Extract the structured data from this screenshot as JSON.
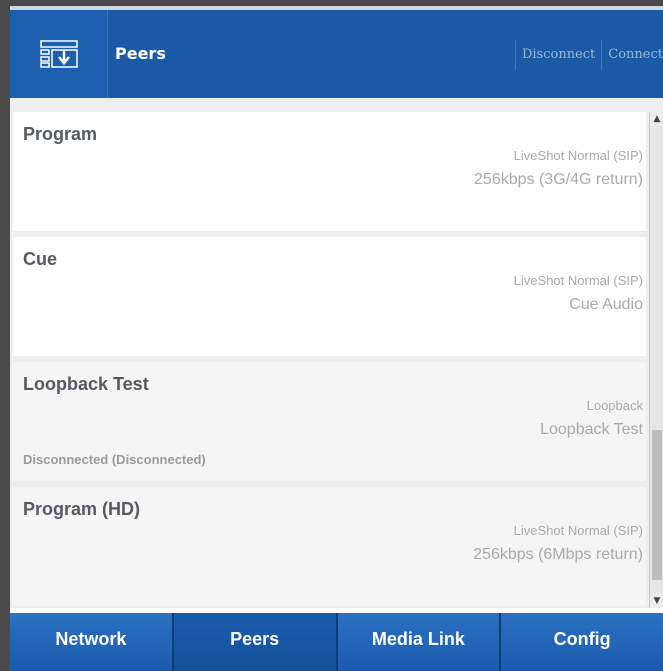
{
  "header": {
    "title": "Peers",
    "actions": [
      "Disconnect",
      "Connect"
    ]
  },
  "peers": [
    {
      "name": "Program",
      "profile": "LiveShot Normal (SIP)",
      "detail": "256kbps (3G/4G return)",
      "status": ""
    },
    {
      "name": "Cue",
      "profile": "LiveShot Normal (SIP)",
      "detail": "Cue Audio",
      "status": ""
    },
    {
      "name": "Loopback Test",
      "profile": "Loopback",
      "detail": "Loopback Test",
      "status": "Disconnected (Disconnected)"
    },
    {
      "name": "Program (HD)",
      "profile": "LiveShot Normal (SIP)",
      "detail": "256kbps (6Mbps return)",
      "status": ""
    }
  ],
  "nav": {
    "tabs": [
      "Network",
      "Peers",
      "Media Link",
      "Config"
    ],
    "active": "Peers"
  },
  "icons": {
    "logo": "download-list-icon",
    "scroll_up": "scroll-up-arrow-icon",
    "scroll_down": "scroll-down-arrow-icon"
  },
  "colors": {
    "header_bg": "#1b5aa5",
    "nav_bg": "#1a5aab",
    "text_muted": "#a9a9a9"
  }
}
